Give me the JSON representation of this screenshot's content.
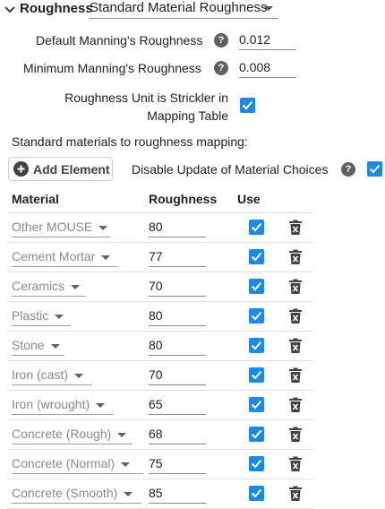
{
  "header": {
    "title": "Roughness",
    "method_value": "Standard Material Roughness"
  },
  "fields": {
    "default_label": "Default Manning's Roughness",
    "default_value": "0.012",
    "minimum_label": "Minimum Manning's Roughness",
    "minimum_value": "0.008",
    "strickler_label_line1": "Roughness Unit is Strickler in",
    "strickler_label_line2": "Mapping Table",
    "strickler_checked": true
  },
  "mapping": {
    "section_label": "Standard materials to roughness mapping:",
    "add_label": "Add Element",
    "disable_update_label": "Disable Update of Material Choices",
    "disable_update_checked": true
  },
  "table": {
    "headers": {
      "material": "Material",
      "roughness": "Roughness",
      "use": "Use"
    },
    "rows": [
      {
        "material": "Other MOUSE",
        "roughness": "80",
        "use": true
      },
      {
        "material": "Cement Mortar",
        "roughness": "77",
        "use": true
      },
      {
        "material": "Ceramics",
        "roughness": "70",
        "use": true
      },
      {
        "material": "Plastic",
        "roughness": "80",
        "use": true
      },
      {
        "material": "Stone",
        "roughness": "80",
        "use": true
      },
      {
        "material": "Iron (cast)",
        "roughness": "70",
        "use": true
      },
      {
        "material": "Iron (wrought)",
        "roughness": "65",
        "use": true
      },
      {
        "material": "Concrete (Rough)",
        "roughness": "68",
        "use": true
      },
      {
        "material": "Concrete (Normal)",
        "roughness": "75",
        "use": true
      },
      {
        "material": "Concrete (Smooth)",
        "roughness": "85",
        "use": true
      }
    ]
  },
  "colors": {
    "accent": "#1e88e5",
    "help_icon": "#616161",
    "placeholder_text": "#8a8a8a"
  }
}
